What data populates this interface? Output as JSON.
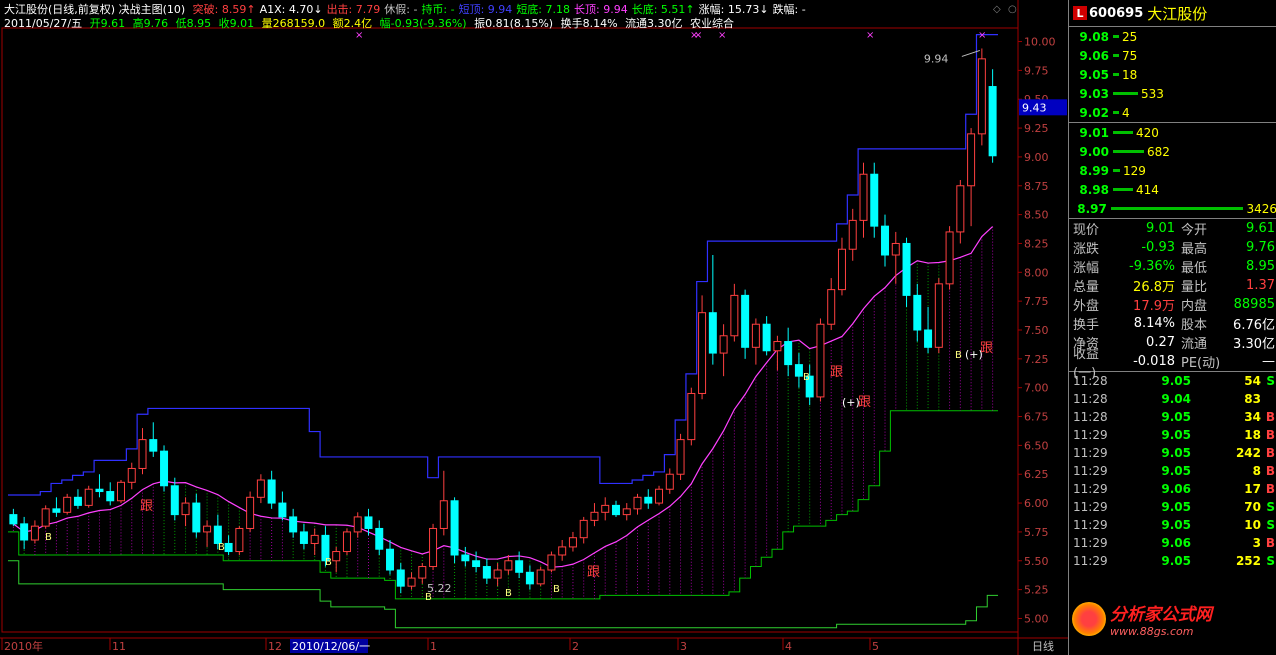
{
  "header": {
    "title": "大江股份(日线,前复权) 决战主图(10)",
    "items": [
      {
        "label": "突破:",
        "value": "8.59",
        "arrow": "↑",
        "color": "#ff4040"
      },
      {
        "label": "A1X:",
        "value": "4.70",
        "arrow": "↓",
        "color": "#ffffff"
      },
      {
        "label": "出击:",
        "value": "7.79",
        "arrow": "",
        "color": "#ff4040"
      },
      {
        "label": "休假:",
        "value": "-",
        "arrow": "",
        "color": "#c0c0c0"
      },
      {
        "label": "持币:",
        "value": "-",
        "arrow": "",
        "color": "#00ff00"
      },
      {
        "label": "短顶:",
        "value": "9.94",
        "arrow": "",
        "color": "#4040ff"
      },
      {
        "label": "短底:",
        "value": "7.18",
        "arrow": "",
        "color": "#00ff00"
      },
      {
        "label": "长顶:",
        "value": "9.94",
        "arrow": "",
        "color": "#ff40ff"
      },
      {
        "label": "长底:",
        "value": "5.51",
        "arrow": "↑",
        "color": "#00ff00"
      },
      {
        "label": "涨幅:",
        "value": "15.73",
        "arrow": "↓",
        "color": "#ffffff"
      },
      {
        "label": "跌幅:",
        "value": "-",
        "arrow": "",
        "color": "#ffffff"
      }
    ],
    "line2": {
      "date": "2011/05/27/五",
      "open": "开9.61",
      "high": "高9.76",
      "low": "低8.95",
      "close": "收9.01",
      "vol": "量268159.0",
      "amount": "额2.4亿",
      "change": "幅-0.93(-9.36%)",
      "amp": "振0.81(8.15%)",
      "turnover": "换手8.14%",
      "float": "流通3.30亿",
      "sector": "农业综合"
    }
  },
  "price_axis": {
    "labels": [
      "10.00",
      "9.75",
      "9.50",
      "9.25",
      "9.00",
      "8.75",
      "8.50",
      "8.25",
      "8.00",
      "7.75",
      "7.50",
      "7.25",
      "7.00",
      "6.75",
      "6.50",
      "6.25",
      "6.00",
      "5.75",
      "5.50",
      "5.25",
      "5.00"
    ],
    "current": "9.43"
  },
  "time_axis": {
    "labels": [
      "2010年",
      "11",
      "12",
      "1",
      "2",
      "3",
      "4",
      "5"
    ],
    "cursor_date": "2010/12/06/一",
    "period": "日线"
  },
  "annotations": {
    "high_label": "9.94",
    "low_label": "5.22",
    "follow": "跟",
    "buy": "B",
    "plus": "(+)"
  },
  "chart_data": {
    "type": "candlestick",
    "title": "大江股份(日线,前复权)",
    "ylim": [
      4.9,
      10.1
    ],
    "candles": [
      [
        5.9,
        5.95,
        5.8,
        5.82
      ],
      [
        5.82,
        5.88,
        5.6,
        5.68
      ],
      [
        5.68,
        5.85,
        5.65,
        5.8
      ],
      [
        5.8,
        5.98,
        5.78,
        5.95
      ],
      [
        5.95,
        6.05,
        5.88,
        5.92
      ],
      [
        5.92,
        6.08,
        5.9,
        6.05
      ],
      [
        6.05,
        6.12,
        5.95,
        5.98
      ],
      [
        5.98,
        6.15,
        5.96,
        6.12
      ],
      [
        6.12,
        6.25,
        6.05,
        6.1
      ],
      [
        6.1,
        6.18,
        5.98,
        6.02
      ],
      [
        6.02,
        6.2,
        6.0,
        6.18
      ],
      [
        6.18,
        6.35,
        6.12,
        6.3
      ],
      [
        6.3,
        6.65,
        6.25,
        6.55
      ],
      [
        6.55,
        6.7,
        6.4,
        6.45
      ],
      [
        6.45,
        6.5,
        6.1,
        6.15
      ],
      [
        6.15,
        6.22,
        5.85,
        5.9
      ],
      [
        5.9,
        6.05,
        5.8,
        6.0
      ],
      [
        6.0,
        6.08,
        5.7,
        5.75
      ],
      [
        5.75,
        5.85,
        5.62,
        5.8
      ],
      [
        5.8,
        5.9,
        5.6,
        5.65
      ],
      [
        5.65,
        5.72,
        5.55,
        5.58
      ],
      [
        5.58,
        5.8,
        5.55,
        5.78
      ],
      [
        5.78,
        6.1,
        5.75,
        6.05
      ],
      [
        6.05,
        6.25,
        6.0,
        6.2
      ],
      [
        6.2,
        6.28,
        5.95,
        6.0
      ],
      [
        6.0,
        6.1,
        5.85,
        5.88
      ],
      [
        5.88,
        5.95,
        5.7,
        5.75
      ],
      [
        5.75,
        5.82,
        5.6,
        5.65
      ],
      [
        5.65,
        5.78,
        5.55,
        5.72
      ],
      [
        5.72,
        5.8,
        5.45,
        5.5
      ],
      [
        5.5,
        5.62,
        5.4,
        5.58
      ],
      [
        5.58,
        5.78,
        5.55,
        5.75
      ],
      [
        5.75,
        5.92,
        5.7,
        5.88
      ],
      [
        5.88,
        5.95,
        5.72,
        5.78
      ],
      [
        5.78,
        5.85,
        5.55,
        5.6
      ],
      [
        5.6,
        5.68,
        5.38,
        5.42
      ],
      [
        5.42,
        5.48,
        5.22,
        5.28
      ],
      [
        5.28,
        5.4,
        5.25,
        5.35
      ],
      [
        5.35,
        5.48,
        5.3,
        5.45
      ],
      [
        5.45,
        5.82,
        5.42,
        5.78
      ],
      [
        5.78,
        6.28,
        5.72,
        6.02
      ],
      [
        6.02,
        6.05,
        5.48,
        5.55
      ],
      [
        5.55,
        5.62,
        5.45,
        5.5
      ],
      [
        5.5,
        5.58,
        5.4,
        5.45
      ],
      [
        5.45,
        5.52,
        5.3,
        5.35
      ],
      [
        5.35,
        5.48,
        5.28,
        5.42
      ],
      [
        5.42,
        5.55,
        5.38,
        5.5
      ],
      [
        5.5,
        5.58,
        5.35,
        5.4
      ],
      [
        5.4,
        5.46,
        5.25,
        5.3
      ],
      [
        5.3,
        5.45,
        5.28,
        5.42
      ],
      [
        5.42,
        5.58,
        5.4,
        5.55
      ],
      [
        5.55,
        5.68,
        5.5,
        5.62
      ],
      [
        5.62,
        5.75,
        5.58,
        5.7
      ],
      [
        5.7,
        5.88,
        5.65,
        5.85
      ],
      [
        5.85,
        6.0,
        5.8,
        5.92
      ],
      [
        5.92,
        6.05,
        5.85,
        5.98
      ],
      [
        5.98,
        6.02,
        5.88,
        5.9
      ],
      [
        5.9,
        6.0,
        5.85,
        5.95
      ],
      [
        5.95,
        6.08,
        5.9,
        6.05
      ],
      [
        6.05,
        6.12,
        5.95,
        6.0
      ],
      [
        6.0,
        6.15,
        5.98,
        6.12
      ],
      [
        6.12,
        6.3,
        6.08,
        6.25
      ],
      [
        6.25,
        6.6,
        6.2,
        6.55
      ],
      [
        6.55,
        7.0,
        6.5,
        6.95
      ],
      [
        6.95,
        7.8,
        6.9,
        7.65
      ],
      [
        7.65,
        8.15,
        7.2,
        7.3
      ],
      [
        7.3,
        7.55,
        7.1,
        7.45
      ],
      [
        7.45,
        7.9,
        7.4,
        7.8
      ],
      [
        7.8,
        7.85,
        7.25,
        7.35
      ],
      [
        7.35,
        7.6,
        7.2,
        7.55
      ],
      [
        7.55,
        7.62,
        7.28,
        7.32
      ],
      [
        7.32,
        7.45,
        7.15,
        7.4
      ],
      [
        7.4,
        7.52,
        7.1,
        7.2
      ],
      [
        7.2,
        7.3,
        7.0,
        7.1
      ],
      [
        7.1,
        7.2,
        6.85,
        6.92
      ],
      [
        6.92,
        7.6,
        6.88,
        7.55
      ],
      [
        7.55,
        7.95,
        7.5,
        7.85
      ],
      [
        7.85,
        8.3,
        7.8,
        8.2
      ],
      [
        8.2,
        8.55,
        8.1,
        8.45
      ],
      [
        8.45,
        8.95,
        8.3,
        8.85
      ],
      [
        8.85,
        8.95,
        8.3,
        8.4
      ],
      [
        8.4,
        8.5,
        8.05,
        8.15
      ],
      [
        8.15,
        8.35,
        7.9,
        8.25
      ],
      [
        8.25,
        8.3,
        7.7,
        7.8
      ],
      [
        7.8,
        7.9,
        7.4,
        7.5
      ],
      [
        7.5,
        7.7,
        7.3,
        7.35
      ],
      [
        7.35,
        7.95,
        7.3,
        7.9
      ],
      [
        7.9,
        8.4,
        7.85,
        8.35
      ],
      [
        8.35,
        8.8,
        8.25,
        8.75
      ],
      [
        8.75,
        9.25,
        8.4,
        9.2
      ],
      [
        9.2,
        9.94,
        9.1,
        9.85
      ],
      [
        9.61,
        9.76,
        8.95,
        9.01
      ]
    ]
  },
  "order_book": [
    {
      "price": "9.08",
      "vol": "25",
      "bar": 4
    },
    {
      "price": "9.06",
      "vol": "75",
      "bar": 4
    },
    {
      "price": "9.05",
      "vol": "18",
      "bar": 4
    },
    {
      "price": "9.03",
      "vol": "533",
      "bar": 18
    },
    {
      "price": "9.02",
      "vol": "4",
      "bar": 4
    },
    {
      "price": "9.01",
      "vol": "420",
      "bar": 14
    },
    {
      "price": "9.00",
      "vol": "682",
      "bar": 22
    },
    {
      "price": "8.99",
      "vol": "129",
      "bar": 5
    },
    {
      "price": "8.98",
      "vol": "414",
      "bar": 14
    },
    {
      "price": "8.97",
      "vol": "3426",
      "bar": 100
    }
  ],
  "stock": {
    "logo": "L",
    "code": "600695",
    "name": "大江股份"
  },
  "stats": [
    {
      "l": "现价",
      "v": "9.01",
      "vc": "#00ff00",
      "l2": "今开",
      "v2": "9.61",
      "v2c": "#00ff00"
    },
    {
      "l": "涨跌",
      "v": "-0.93",
      "vc": "#00ff00",
      "l2": "最高",
      "v2": "9.76",
      "v2c": "#00ff00"
    },
    {
      "l": "涨幅",
      "v": "-9.36%",
      "vc": "#00ff00",
      "l2": "最低",
      "v2": "8.95",
      "v2c": "#00ff00"
    },
    {
      "l": "总量",
      "v": "26.8万",
      "vc": "#ffff00",
      "l2": "量比",
      "v2": "1.37",
      "v2c": "#ff4040"
    },
    {
      "l": "外盘",
      "v": "17.9万",
      "vc": "#ff4040",
      "l2": "内盘",
      "v2": "88985",
      "v2c": "#00ff00"
    },
    {
      "l": "换手",
      "v": "8.14%",
      "vc": "#ffffff",
      "l2": "股本",
      "v2": "6.76亿",
      "v2c": "#ffffff"
    },
    {
      "l": "净资",
      "v": "0.27",
      "vc": "#ffffff",
      "l2": "流通",
      "v2": "3.30亿",
      "v2c": "#ffffff"
    },
    {
      "l": "收益(一)",
      "v": "-0.018",
      "vc": "#ffffff",
      "l2": "PE(动)",
      "v2": "—",
      "v2c": "#ffffff"
    }
  ],
  "ticks": [
    {
      "t": "11:28",
      "p": "9.05",
      "q": "54",
      "d": "S",
      "dc": "#00ff00"
    },
    {
      "t": "11:28",
      "p": "9.04",
      "q": "83",
      "d": "",
      "dc": "#ffffff"
    },
    {
      "t": "11:28",
      "p": "9.05",
      "q": "34",
      "d": "B",
      "dc": "#ff4040"
    },
    {
      "t": "11:29",
      "p": "9.05",
      "q": "18",
      "d": "B",
      "dc": "#ff4040"
    },
    {
      "t": "11:29",
      "p": "9.05",
      "q": "242",
      "d": "B",
      "dc": "#ff4040"
    },
    {
      "t": "11:29",
      "p": "9.05",
      "q": "8",
      "d": "B",
      "dc": "#ff4040"
    },
    {
      "t": "11:29",
      "p": "9.06",
      "q": "17",
      "d": "B",
      "dc": "#ff4040"
    },
    {
      "t": "11:29",
      "p": "9.05",
      "q": "70",
      "d": "S",
      "dc": "#00ff00"
    },
    {
      "t": "11:29",
      "p": "9.05",
      "q": "10",
      "d": "S",
      "dc": "#00ff00"
    },
    {
      "t": "11:29",
      "p": "9.06",
      "q": "3",
      "d": "B",
      "dc": "#ff4040"
    },
    {
      "t": "11:29",
      "p": "9.05",
      "q": "252",
      "d": "S",
      "dc": "#00ff00"
    }
  ],
  "watermark": {
    "t1": "分析家公式网",
    "t2": "www.88gs.com"
  }
}
